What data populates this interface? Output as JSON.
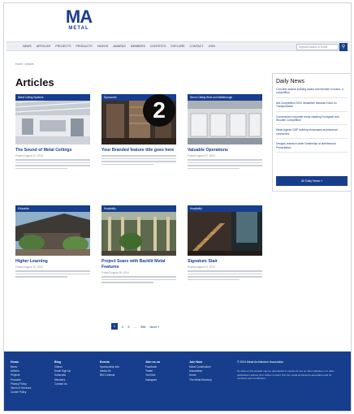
{
  "logo": {
    "brand": "MA",
    "name": "METAL",
    "tagline": ""
  },
  "nav": {
    "items": [
      "NEWS",
      "ARTICLES",
      "PROJECTS",
      "PRODUCTS",
      "VIDEOS",
      "AWARDS",
      "MEMBERS",
      "CONTESTS",
      "EXPLORE",
      "CONTACT",
      "JOIN"
    ]
  },
  "search": {
    "placeholder": "Keyword search & Home",
    "icon": "search-icon"
  },
  "breadcrumb": "Home / Articles",
  "page_title": "Articles",
  "cards": [
    {
      "tag": "Metal Ceiling Systems",
      "title": "The Sound of Metal Ceilings",
      "date": "Posted August 10, 2024"
    },
    {
      "tag": "Sponsored",
      "title": "Your Branded feature title goes here",
      "date": ""
    },
    {
      "tag": "Storm Ceiling Wind and Walkthrough",
      "title": "Valuable Operations",
      "date": "Posted August 07, 2024"
    },
    {
      "tag": "Education",
      "title": "Higher Learning",
      "date": "Posted August 15, 2024"
    },
    {
      "tag": "Hospitality",
      "title": "Project Soars with Backlit Metal Features",
      "date": "Posted August 08, 2024"
    },
    {
      "tag": "Hospitality",
      "title": "Signature Stair",
      "date": "Posted August 01, 2024"
    }
  ],
  "daily_news": {
    "title": "Daily News",
    "items": [
      "Concrete awards building award and element in brand, a competition",
      "AIA Competition 2024 newsletter released Novo on Transportation",
      "Construction corporate metal cladding Foodgrain and Wooden Competition",
      "Metal Agents CMP building showcases architectural contractors",
      "Designs research ceiler Dealership at architectural Presentation"
    ],
    "more_label": "All Daily News »"
  },
  "pagination": {
    "current": "1",
    "pages": [
      "2",
      "3",
      "...",
      "396"
    ],
    "next": "Next »"
  },
  "footer": {
    "columns": [
      {
        "heading": "Home",
        "links": [
          "News",
          "Articles",
          "Projects",
          "Products",
          "Privacy Policy",
          "Terms of Services",
          "Cookie Policy"
        ]
      },
      {
        "heading": "Blog",
        "links": [
          "Videos",
          "Email Sign Up",
          "Subscribe",
          "Members",
          "Contact Us"
        ]
      },
      {
        "heading": "Events",
        "links": [
          "Sponsorship Info",
          "Media Kit",
          "BM Contests"
        ]
      },
      {
        "heading": "Join us on",
        "links": [
          "Facebook",
          "Twitter",
          "YouTube",
          "Instagram"
        ]
      },
      {
        "heading": "Join Now",
        "links": [
          "Metal Construction",
          "Association",
          "Home",
          "The Metal Directory"
        ]
      }
    ],
    "copyright": "© 2024 Metal Architecture Association",
    "note": "No data on this website may be reproduced or copied for use on other websites or in other publications without prior written consent from the metal architecture association and its members and contributors."
  },
  "overlay_badge": "2",
  "colors": {
    "brand": "#173e8c",
    "nav_bg": "#eceff3",
    "footer_bg": "#173e8c"
  }
}
